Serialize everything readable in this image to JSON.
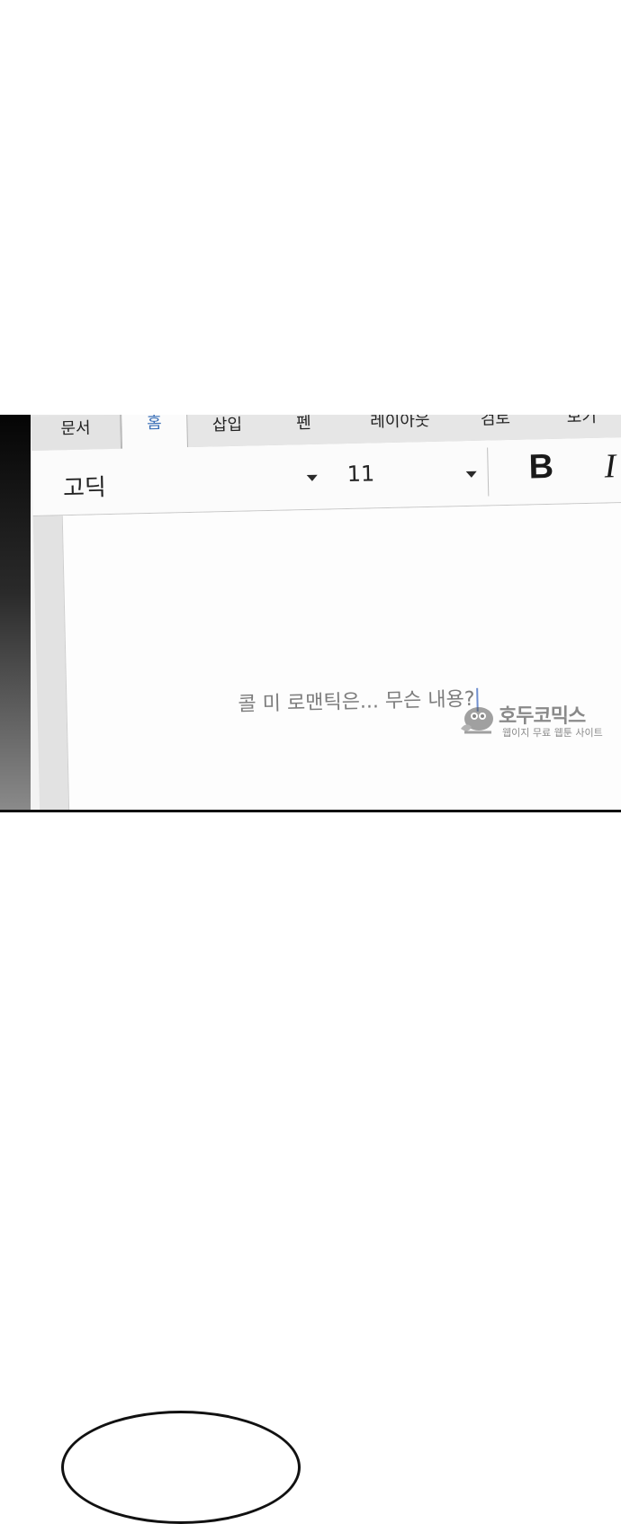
{
  "tabs": [
    {
      "label": "문서"
    },
    {
      "label": "홈"
    },
    {
      "label": "삽입"
    },
    {
      "label": "펜"
    },
    {
      "label": "레이아웃"
    },
    {
      "label": "검토"
    },
    {
      "label": "보기"
    }
  ],
  "active_tab": "홈",
  "ribbon": {
    "font_name": "고딕",
    "font_size": "11",
    "bold_label": "B",
    "italic_label": "I"
  },
  "document": {
    "text": "콜 미 로맨틱은... 무슨 내용?"
  },
  "watermark": {
    "title": "호두코믹스",
    "subtitle": "웹이지 무료 웹툰 사이트"
  },
  "colors": {
    "active_tab_text": "#3a6fb7",
    "document_text": "#7d7d7d",
    "cursor": "#6f8fd0"
  }
}
